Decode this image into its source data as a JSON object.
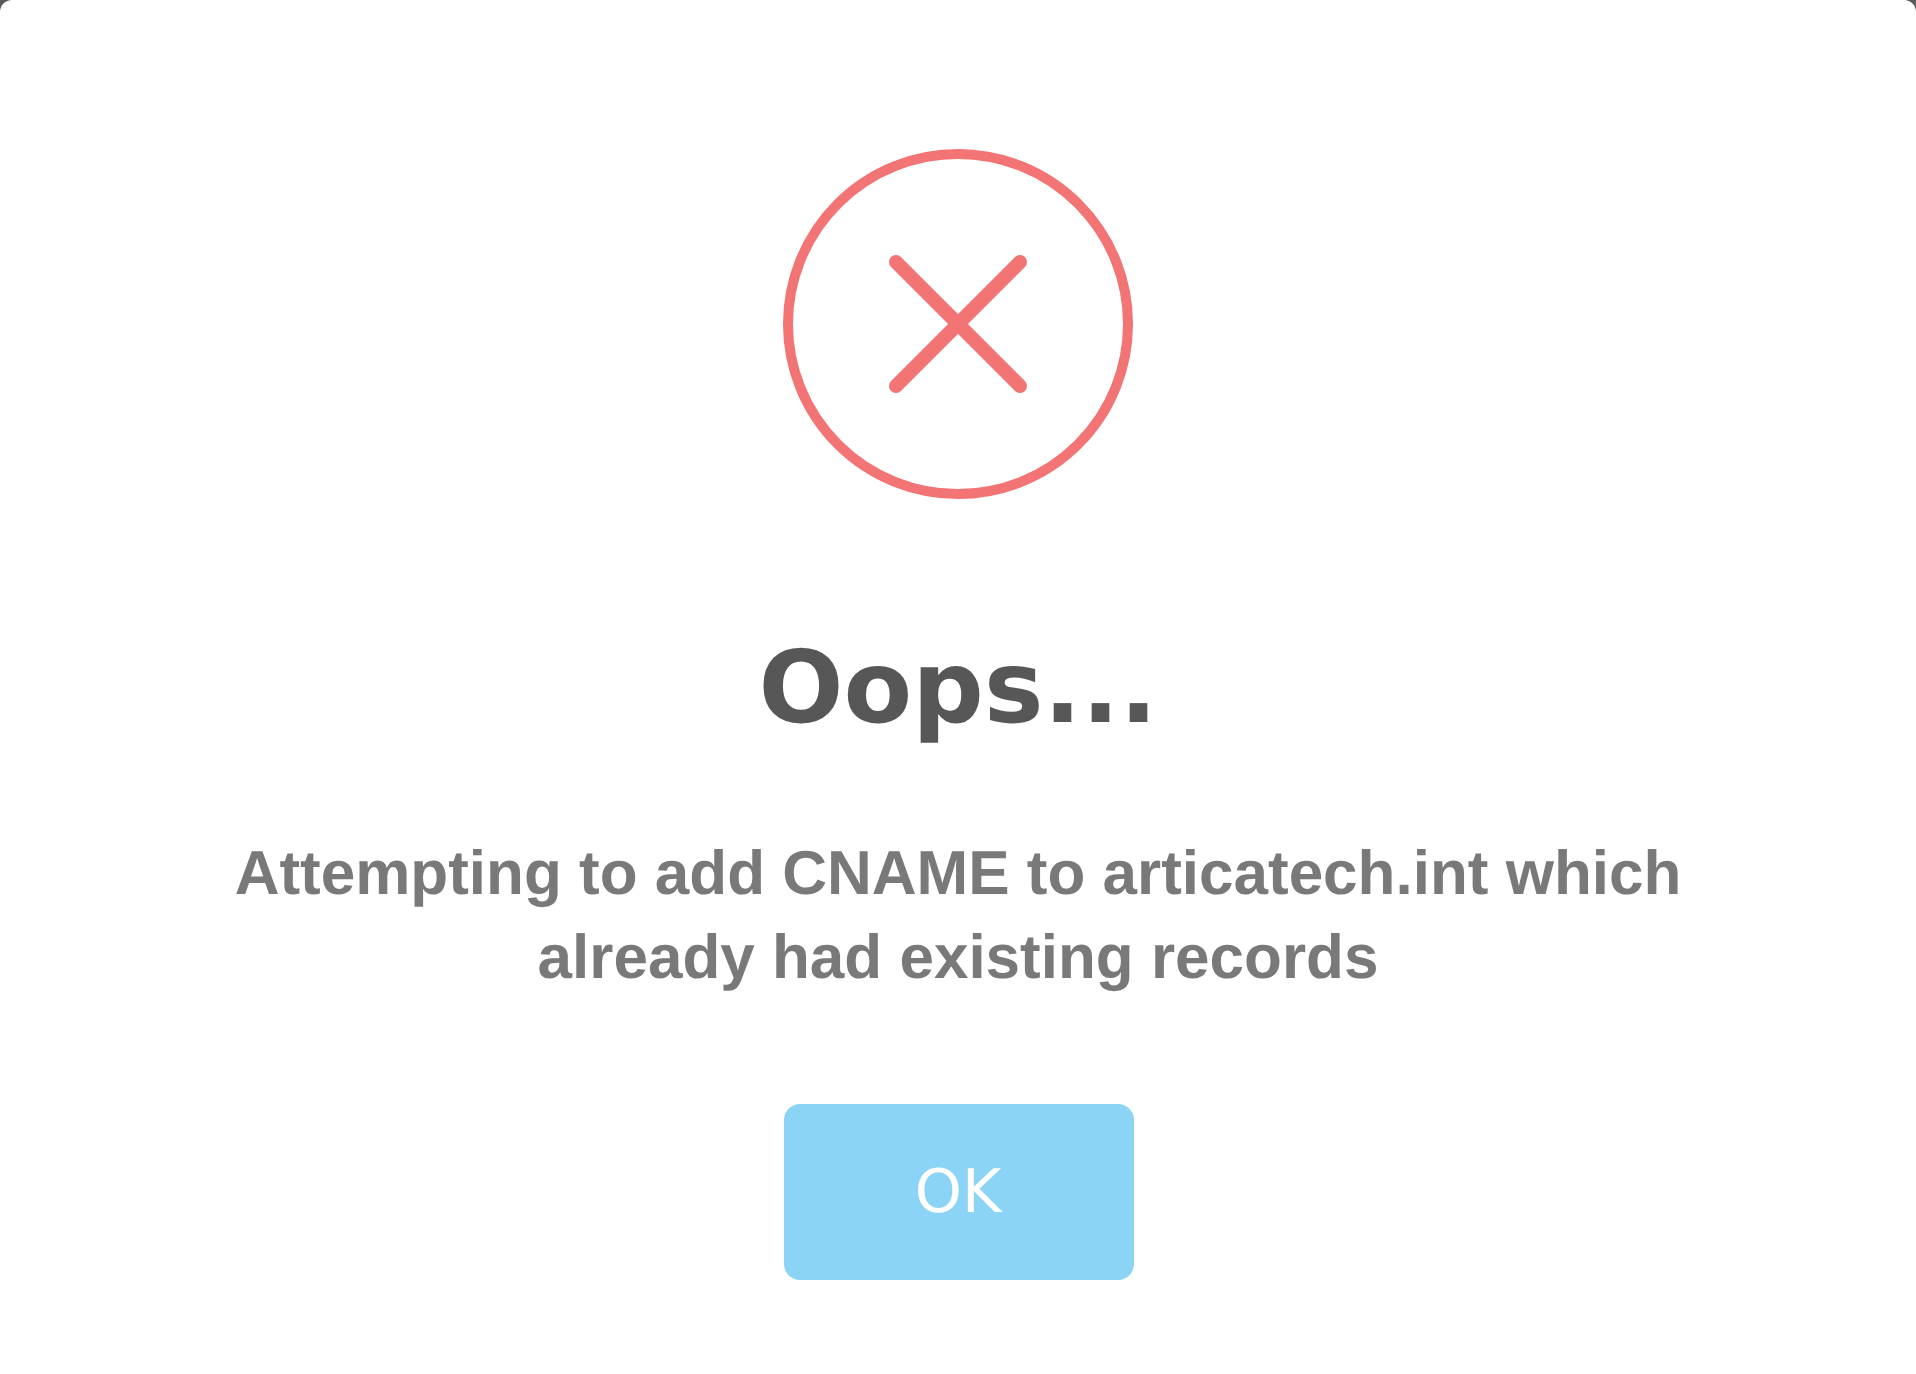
{
  "dialog": {
    "title": "Oops...",
    "message": "Attempting to add CNAME to articatech.int which already had existing records",
    "buttons": [
      {
        "label": "OK"
      }
    ]
  }
}
